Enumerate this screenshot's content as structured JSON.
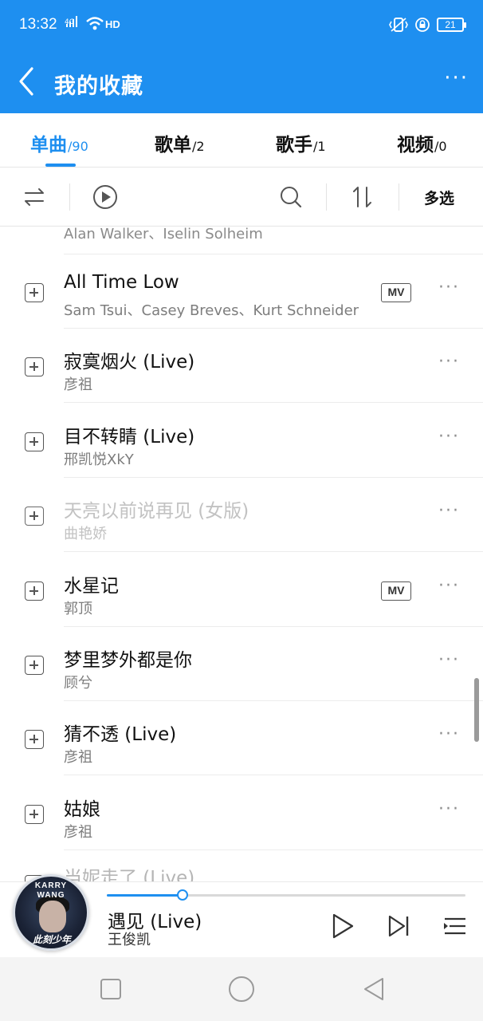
{
  "status_bar": {
    "time": "13:32",
    "signal_label": "4G",
    "wifi_label": "HD",
    "battery": "21"
  },
  "header": {
    "title": "我的收藏",
    "more": "···"
  },
  "tabs": [
    {
      "label": "单曲",
      "count": "/90",
      "active": true
    },
    {
      "label": "歌单",
      "count": "/2",
      "active": false
    },
    {
      "label": "歌手",
      "count": "/1",
      "active": false
    },
    {
      "label": "视频",
      "count": "/0",
      "active": false
    }
  ],
  "toolbar": {
    "multi_select": "多选"
  },
  "list": {
    "partial_top_artist": "Alan Walker、Iselin Solheim",
    "songs": [
      {
        "title": "All Time Low",
        "artist": "Sam Tsui、Casey Breves、Kurt Schneider",
        "mv": "MV",
        "dim": false
      },
      {
        "title": "寂寞烟火 (Live)",
        "artist": "彦祖",
        "mv": "",
        "dim": false
      },
      {
        "title": "目不转睛 (Live)",
        "artist": "邢凯悦XkY",
        "mv": "",
        "dim": false
      },
      {
        "title": "天亮以前说再见 (女版)",
        "artist": "曲艳娇",
        "mv": "",
        "dim": true
      },
      {
        "title": "水星记",
        "artist": "郭顶",
        "mv": "MV",
        "dim": false
      },
      {
        "title": "梦里梦外都是你",
        "artist": "顾兮",
        "mv": "",
        "dim": false
      },
      {
        "title": "猜不透 (Live)",
        "artist": "彦祖",
        "mv": "",
        "dim": false
      },
      {
        "title": "姑娘",
        "artist": "彦祖",
        "mv": "",
        "dim": false
      }
    ],
    "partial_bottom_title": "当妮走了 (Live)",
    "row_more": "···"
  },
  "player": {
    "cover_text_1": "KARRY",
    "cover_text_2": "WANG",
    "cover_signature": "此刻少年",
    "title": "遇见 (Live)",
    "artist": "王俊凯",
    "progress": 0.21
  },
  "colors": {
    "accent": "#1e8ff0",
    "text_primary": "#111111",
    "text_secondary": "#7d7d7d",
    "text_disabled": "#c2c2c2"
  },
  "icons": {
    "back": "chevron-left-icon",
    "more": "more-dots-icon",
    "shuffle": "shuffle-icon",
    "play_all": "play-circle-icon",
    "search": "search-icon",
    "sort": "sort-icon",
    "add": "add-square-icon",
    "mv": "mv-badge-icon",
    "play": "play-icon",
    "next": "skip-next-icon",
    "queue": "playlist-icon",
    "nav_recent": "square-icon",
    "nav_home": "circle-icon",
    "nav_back": "triangle-back-icon"
  }
}
